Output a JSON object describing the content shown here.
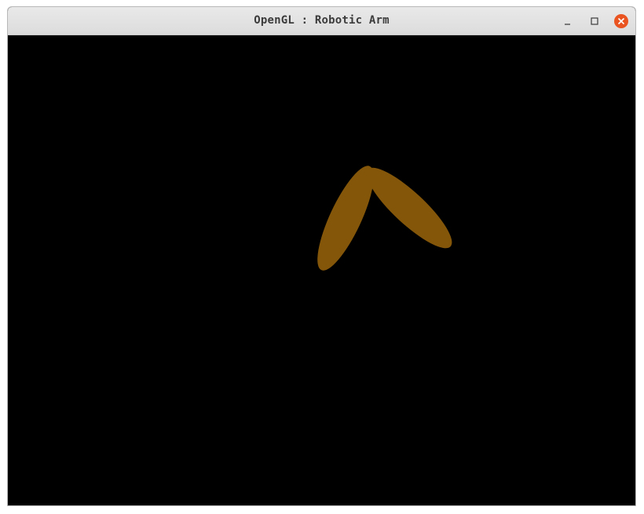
{
  "window": {
    "title": "OpenGL : Robotic Arm"
  },
  "controls": {
    "minimize_icon": "minimize-icon",
    "maximize_icon": "maximize-icon",
    "close_icon": "close-icon"
  },
  "colors": {
    "canvas_background": "#000000",
    "arm_segment": "#83560a",
    "close_button": "#e95420"
  }
}
